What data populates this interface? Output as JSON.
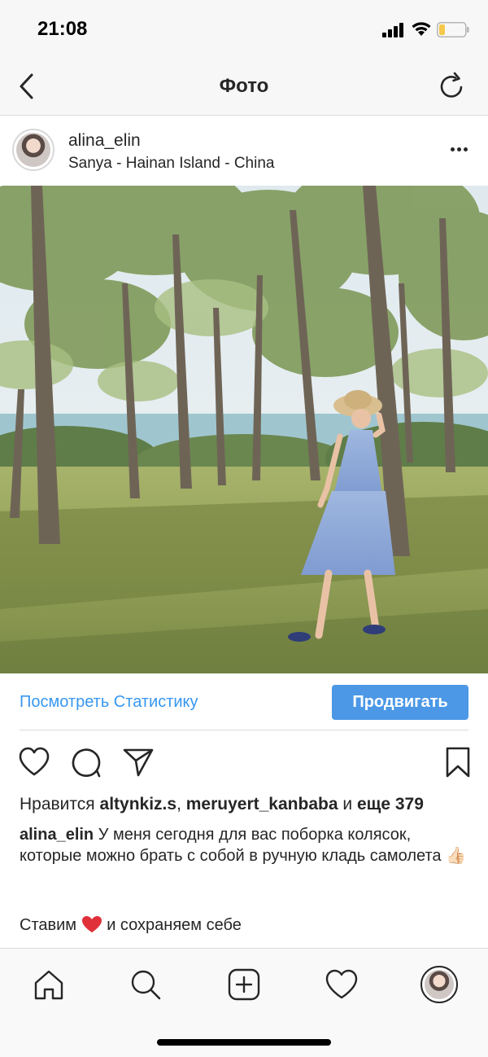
{
  "status_bar": {
    "time": "21:08",
    "signal_icon": "cellular-signal-icon",
    "wifi_icon": "wifi-icon",
    "battery_icon": "battery-low-icon",
    "battery_color": "#f5c84b"
  },
  "nav": {
    "title": "Фото",
    "back_icon": "chevron-left-icon",
    "refresh_icon": "refresh-icon"
  },
  "post": {
    "username": "alina_elin",
    "location": "Sanya - Hainan Island - China",
    "more_icon": "more-dots-icon"
  },
  "insights": {
    "view_stats_label": "Посмотреть Статистику",
    "promote_label": "Продвигать",
    "accent_color": "#3897f0",
    "button_color": "#4c98e6"
  },
  "actions": {
    "like_icon": "heart-icon",
    "comment_icon": "comment-icon",
    "share_icon": "send-icon",
    "save_icon": "bookmark-icon"
  },
  "likes": {
    "prefix": "Нравится",
    "user1": "altynkiz.s",
    "separator": ",",
    "user2": "meruyert_kanbaba",
    "and": "и",
    "others": "еще 379"
  },
  "caption": {
    "username": "alina_elin",
    "text": "У меня сегодня для вас поборка колясок, которые можно брать с собой в ручную кладь самолета 👍🏻",
    "line2_before": "Ставим",
    "line2_after": "и сохраняем себе"
  },
  "tabbar": {
    "items": [
      "home-icon",
      "search-icon",
      "add-post-icon",
      "activity-heart-icon",
      "profile-avatar"
    ]
  }
}
